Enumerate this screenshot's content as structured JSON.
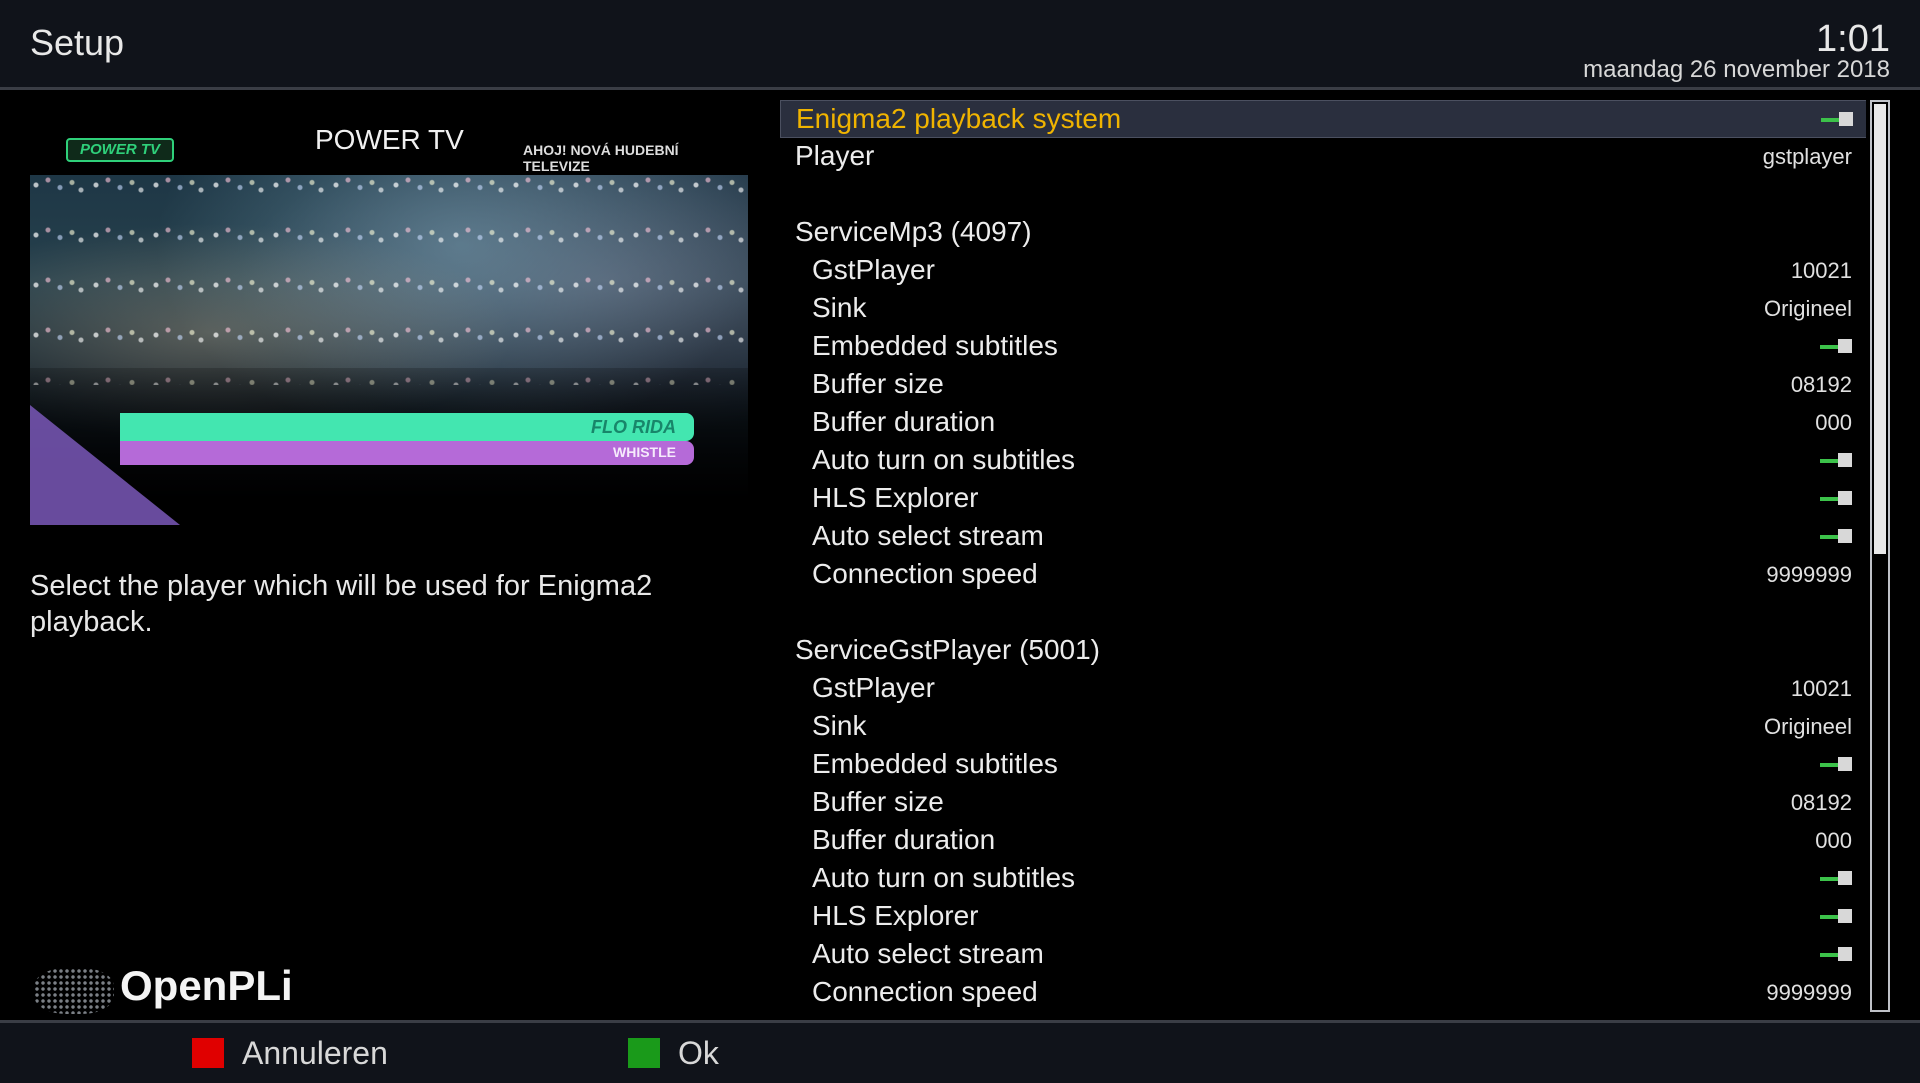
{
  "header": {
    "title": "Setup",
    "clock": "1:01",
    "date": "maandag 26 november 2018"
  },
  "preview": {
    "channel_logo": "POWER TV",
    "channel_name": "POWER TV",
    "tagline": "AHOJ! NOVÁ HUDEBNÍ TELEVIZE",
    "artist": "FLO RIDA",
    "song": "WHISTLE"
  },
  "description": "Select the player which will be used for Enigma2 playback.",
  "brand": "OpenPLi",
  "config": {
    "rows": [
      {
        "label": "Enigma2 playback system",
        "kind": "toggle",
        "indent": 0,
        "selected": true,
        "state": "on"
      },
      {
        "label": "Player",
        "kind": "value",
        "value": "gstplayer",
        "indent": 0
      },
      {
        "label": "",
        "kind": "blank"
      },
      {
        "label": "ServiceMp3 (4097)",
        "kind": "section",
        "indent": 0
      },
      {
        "label": "GstPlayer",
        "kind": "value",
        "value": "10021",
        "indent": 1
      },
      {
        "label": "Sink",
        "kind": "value",
        "value": "Origineel",
        "indent": 1
      },
      {
        "label": "Embedded subtitles",
        "kind": "toggle",
        "state": "on",
        "indent": 1
      },
      {
        "label": "Buffer size",
        "kind": "value",
        "value": "08192",
        "indent": 1
      },
      {
        "label": "Buffer duration",
        "kind": "value",
        "value": "000",
        "indent": 1
      },
      {
        "label": "Auto turn on subtitles",
        "kind": "toggle",
        "state": "on",
        "indent": 1
      },
      {
        "label": "HLS Explorer",
        "kind": "toggle",
        "state": "on",
        "indent": 1
      },
      {
        "label": "Auto select stream",
        "kind": "toggle",
        "state": "on",
        "indent": 1
      },
      {
        "label": "Connection speed",
        "kind": "value",
        "value": "9999999",
        "indent": 1
      },
      {
        "label": "",
        "kind": "blank"
      },
      {
        "label": "ServiceGstPlayer (5001)",
        "kind": "section",
        "indent": 0
      },
      {
        "label": "GstPlayer",
        "kind": "value",
        "value": "10021",
        "indent": 1
      },
      {
        "label": "Sink",
        "kind": "value",
        "value": "Origineel",
        "indent": 1
      },
      {
        "label": "Embedded subtitles",
        "kind": "toggle",
        "state": "on",
        "indent": 1
      },
      {
        "label": "Buffer size",
        "kind": "value",
        "value": "08192",
        "indent": 1
      },
      {
        "label": "Buffer duration",
        "kind": "value",
        "value": "000",
        "indent": 1
      },
      {
        "label": "Auto turn on subtitles",
        "kind": "toggle",
        "state": "on",
        "indent": 1
      },
      {
        "label": "HLS Explorer",
        "kind": "toggle",
        "state": "on",
        "indent": 1
      },
      {
        "label": "Auto select stream",
        "kind": "toggle",
        "state": "on",
        "indent": 1
      },
      {
        "label": "Connection speed",
        "kind": "value",
        "value": "9999999",
        "indent": 1
      }
    ],
    "scroll_position": 0.0
  },
  "footer": {
    "cancel_label": "Annuleren",
    "ok_label": "Ok",
    "cancel_color": "#e00000",
    "ok_color": "#1a9a1a"
  },
  "colors": {
    "selected_text": "#f0b400",
    "toggle_on": "#3cc24a"
  }
}
